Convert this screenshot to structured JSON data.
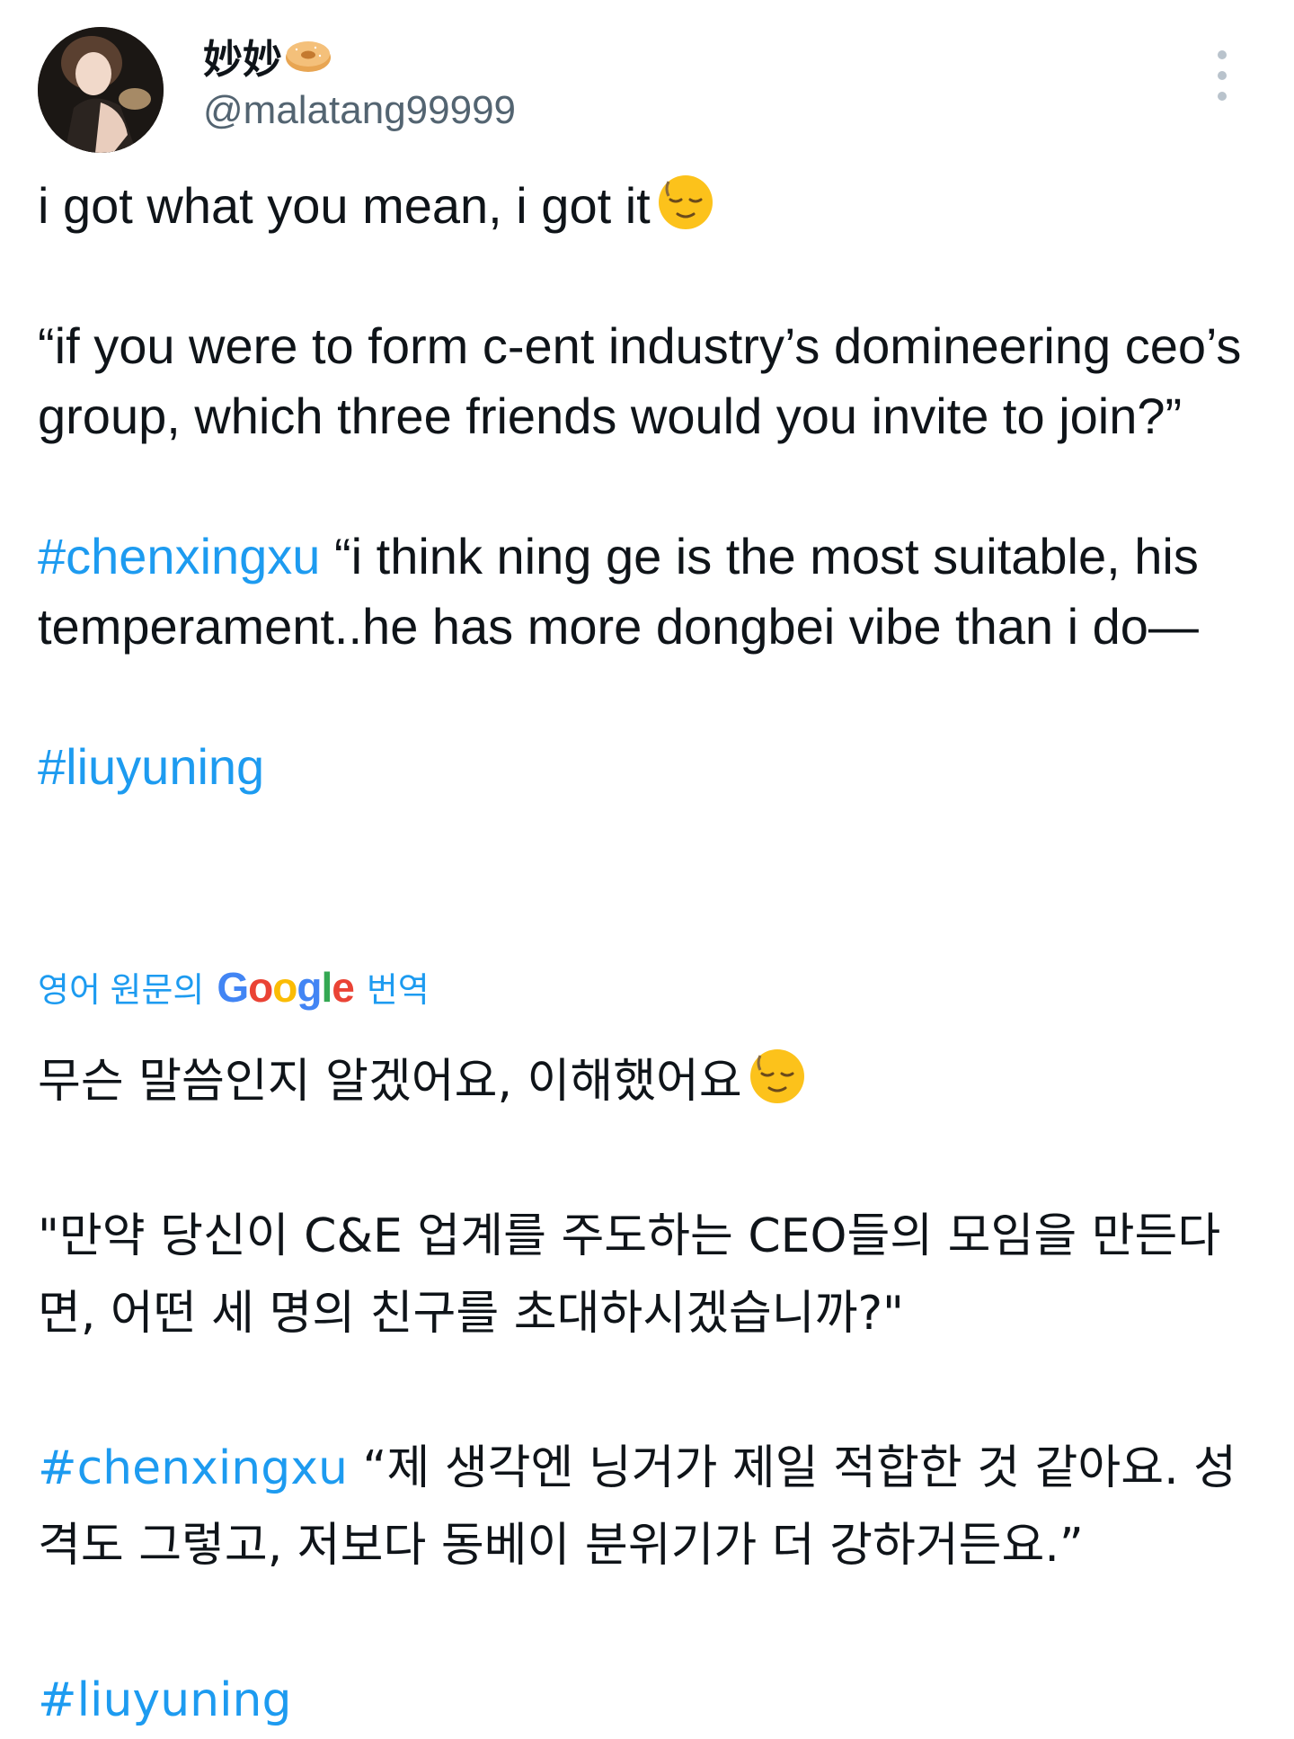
{
  "user": {
    "display_name": "妙妙",
    "handle": "@malatang99999",
    "name_emoji": "bagel-icon"
  },
  "more_menu": {
    "icon": "more-vertical-icon"
  },
  "tweet_text": {
    "line1": "i got what you mean, i got it",
    "para2": "“if you were to form c-ent industry’s domineering ceo’s group, which three friends would you invite to join?”",
    "para3_tag": "#chenxingxu",
    "para3_text": " “i think ning ge is the most suitable, his temperament..he has more dongbei vibe than i do—",
    "para4_tag": "#liuyuning"
  },
  "translation": {
    "prefix": "영어 원문의",
    "google": {
      "G": "G",
      "o1": "o",
      "o2": "o",
      "g": "g",
      "l": "l",
      "e": "e"
    },
    "suffix": "번역",
    "line1": "무슨 말씀인지 알겠어요, 이해했어요",
    "para2": "\"만약 당신이 C&E 업계를 주도하는 CEO들의 모임을 만든다면, 어떤 세 명의 친구를 초대하시겠습니까?\"",
    "para3_tag": "#chenxingxu",
    "para3_text": " “제 생각엔 닝거가 제일 적합한 것 같아요. 성격도 그렇고, 저보다 동베이 분위기가 더 강하거든요.”",
    "para4_tag": "#liuyuning"
  },
  "colors": {
    "link": "#1d9bf0",
    "text": "#0f1419",
    "secondary": "#536471"
  }
}
